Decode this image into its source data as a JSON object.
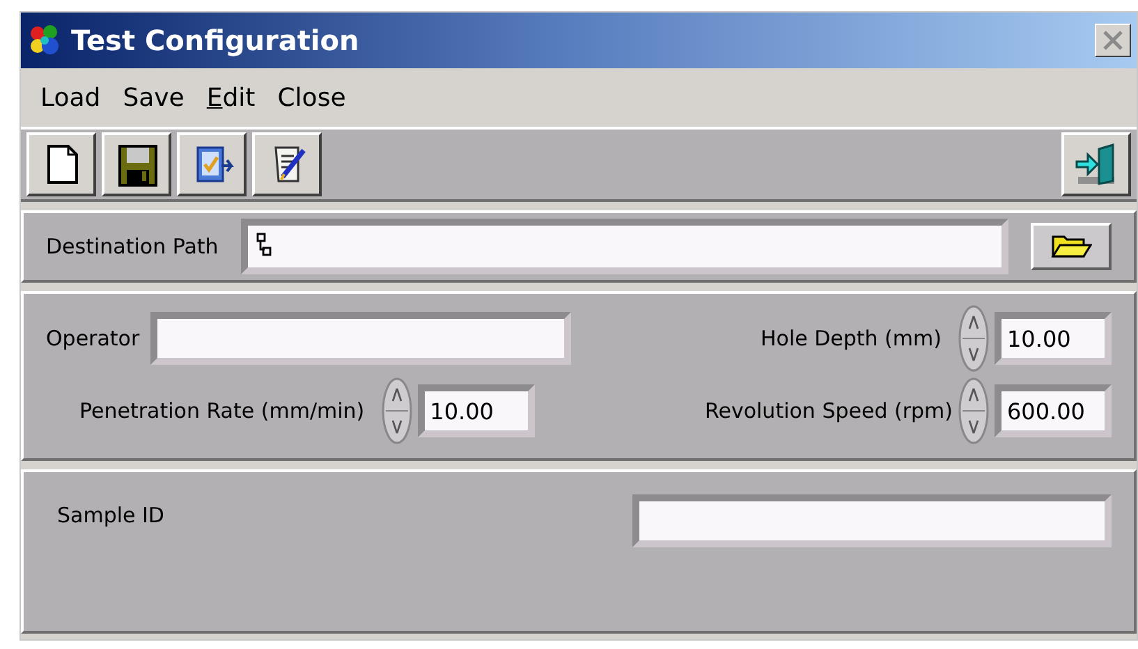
{
  "window": {
    "title": "Test Configuration"
  },
  "menu": [
    {
      "label": "Load",
      "mnemonic": false
    },
    {
      "label": "Save",
      "mnemonic": false
    },
    {
      "label": "Edit",
      "mnemonic": true
    },
    {
      "label": "Close",
      "mnemonic": false
    }
  ],
  "destination": {
    "label": "Destination Path"
  },
  "parameters": {
    "operator": {
      "label": "Operator"
    },
    "penetration_rate": {
      "label": "Penetration Rate (mm/min)",
      "value": "10.00"
    },
    "hole_depth": {
      "label": "Hole Depth (mm)",
      "value": "10.00"
    },
    "revolution_speed": {
      "label": "Revolution Speed (rpm)",
      "value": "600.00"
    }
  },
  "sample": {
    "label": "Sample ID"
  }
}
